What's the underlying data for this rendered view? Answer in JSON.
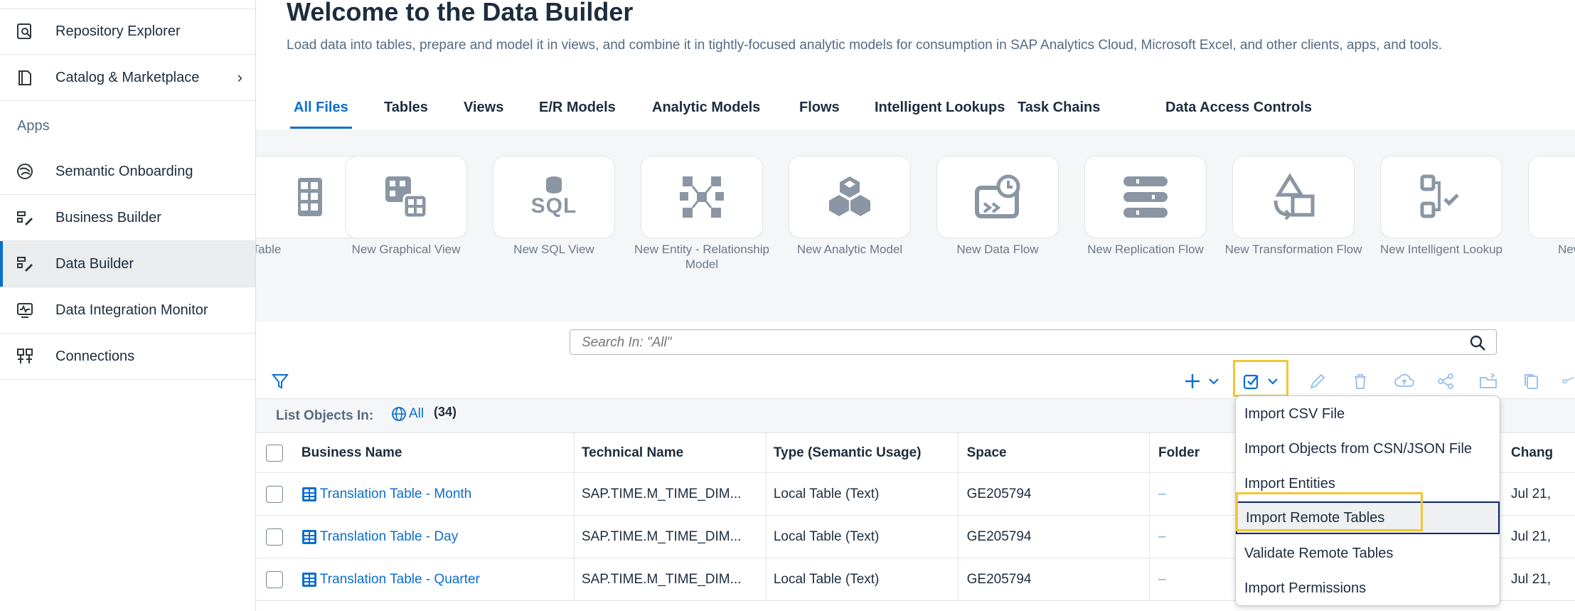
{
  "sidebar": {
    "items": [
      {
        "label": "Repository Explorer",
        "icon": "repository-icon"
      },
      {
        "label": "Catalog & Marketplace",
        "icon": "catalog-icon",
        "chevron": "›"
      },
      {
        "label": "Semantic Onboarding",
        "icon": "semantic-icon"
      },
      {
        "label": "Business Builder",
        "icon": "business-builder-icon"
      },
      {
        "label": "Data Builder",
        "icon": "data-builder-icon"
      },
      {
        "label": "Data Integration Monitor",
        "icon": "monitor-icon"
      },
      {
        "label": "Connections",
        "icon": "connections-icon"
      }
    ],
    "section_apps": "Apps"
  },
  "header": {
    "title": "Welcome to the Data Builder",
    "subtitle": "Load data into tables, prepare and model it in views, and combine it in tightly-focused analytic models for consumption in SAP Analytics Cloud, Microsoft Excel, and other clients, apps, and tools."
  },
  "tabs": [
    {
      "label": "All Files"
    },
    {
      "label": "Tables"
    },
    {
      "label": "Views"
    },
    {
      "label": "E/R Models"
    },
    {
      "label": "Analytic Models"
    },
    {
      "label": "Flows"
    },
    {
      "label": "Intelligent Lookups"
    },
    {
      "label": "Task Chains"
    },
    {
      "label": "Data Access Controls"
    }
  ],
  "tiles": [
    {
      "label": "Table"
    },
    {
      "label": "New Graphical View"
    },
    {
      "label": "New SQL View",
      "icon_text": "SQL"
    },
    {
      "label": "New Entity - Relationship Model"
    },
    {
      "label": "New Analytic Model"
    },
    {
      "label": "New Data Flow"
    },
    {
      "label": "New Replication Flow"
    },
    {
      "label": "New Transformation Flow"
    },
    {
      "label": "New Intelligent Lookup"
    },
    {
      "label": "New"
    }
  ],
  "search": {
    "placeholder": "Search In: \"All\""
  },
  "list": {
    "label": "List Objects In:",
    "scope": "All",
    "count": "(34)"
  },
  "table": {
    "columns": [
      "Business Name",
      "Technical Name",
      "Type (Semantic Usage)",
      "Space",
      "Folder",
      "Chang"
    ],
    "rows": [
      {
        "business_name": "Translation Table - Month",
        "technical_name": "SAP.TIME.M_TIME_DIM...",
        "type": "Local Table (Text)",
        "space": "GE205794",
        "folder": "–",
        "changed": "Jul 21,"
      },
      {
        "business_name": "Translation Table - Day",
        "technical_name": "SAP.TIME.M_TIME_DIM...",
        "type": "Local Table (Text)",
        "space": "GE205794",
        "folder": "–",
        "changed": "Jul 21,"
      },
      {
        "business_name": "Translation Table - Quarter",
        "technical_name": "SAP.TIME.M_TIME_DIM...",
        "type": "Local Table (Text)",
        "space": "GE205794",
        "folder": "–",
        "changed": "Jul 21,"
      }
    ]
  },
  "import_menu": {
    "items": [
      {
        "label": "Import CSV File"
      },
      {
        "label": "Import Objects from CSN/JSON File"
      },
      {
        "label": "Import Entities"
      },
      {
        "label": "Import Remote Tables"
      },
      {
        "label": "Validate Remote Tables"
      },
      {
        "label": "Import Permissions"
      }
    ],
    "selected_index": 3
  },
  "colors": {
    "accent": "#0a6ed1",
    "highlight": "#f3c631",
    "icon_gray": "#8a96a3"
  }
}
